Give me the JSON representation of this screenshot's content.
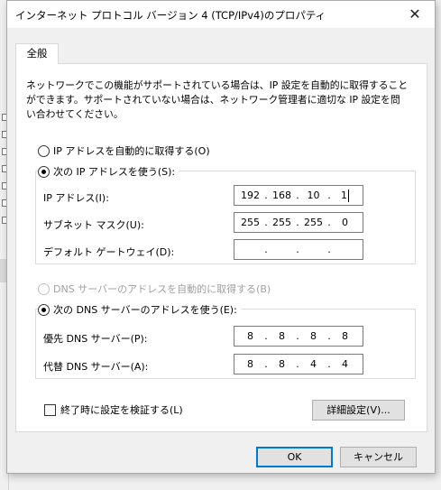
{
  "dialog": {
    "title": "インターネット プロトコル バージョン 4 (TCP/IPv4)のプロパティ",
    "close_glyph": "✕",
    "tab_general": "全般",
    "description": "ネットワークでこの機能がサポートされている場合は、IP 設定を自動的に取得することができます。サポートされていない場合は、ネットワーク管理者に適切な IP 設定を問い合わせてください。"
  },
  "ip": {
    "auto_label": "IP アドレスを自動的に取得する(O)",
    "manual_label": "次の IP アドレスを使う(S):",
    "selected": "manual",
    "address_label": "IP アドレス(I):",
    "address": [
      "192",
      "168",
      "10",
      "1"
    ],
    "subnet_label": "サブネット マスク(U):",
    "subnet": [
      "255",
      "255",
      "255",
      "0"
    ],
    "gateway_label": "デフォルト ゲートウェイ(D):",
    "gateway": [
      "",
      "",
      "",
      ""
    ]
  },
  "dns": {
    "auto_label": "DNS サーバーのアドレスを自動的に取得する(B)",
    "manual_label": "次の DNS サーバーのアドレスを使う(E):",
    "selected": "manual",
    "preferred_label": "優先 DNS サーバー(P):",
    "preferred": [
      "8",
      "8",
      "8",
      "8"
    ],
    "alternate_label": "代替 DNS サーバー(A):",
    "alternate": [
      "8",
      "8",
      "4",
      "4"
    ]
  },
  "footer": {
    "validate_label": "終了時に設定を検証する(L)",
    "validate_checked": false,
    "advanced_button": "詳細設定(V)...",
    "ok_button": "OK",
    "cancel_button": "キャンセル"
  },
  "icons": {
    "close": "close-icon",
    "caret": "text-caret"
  },
  "colors": {
    "accent": "#0078d7",
    "window_bg": "#f0f0f0",
    "panel_bg": "#ffffff",
    "disabled_text": "#a0a0a0"
  }
}
